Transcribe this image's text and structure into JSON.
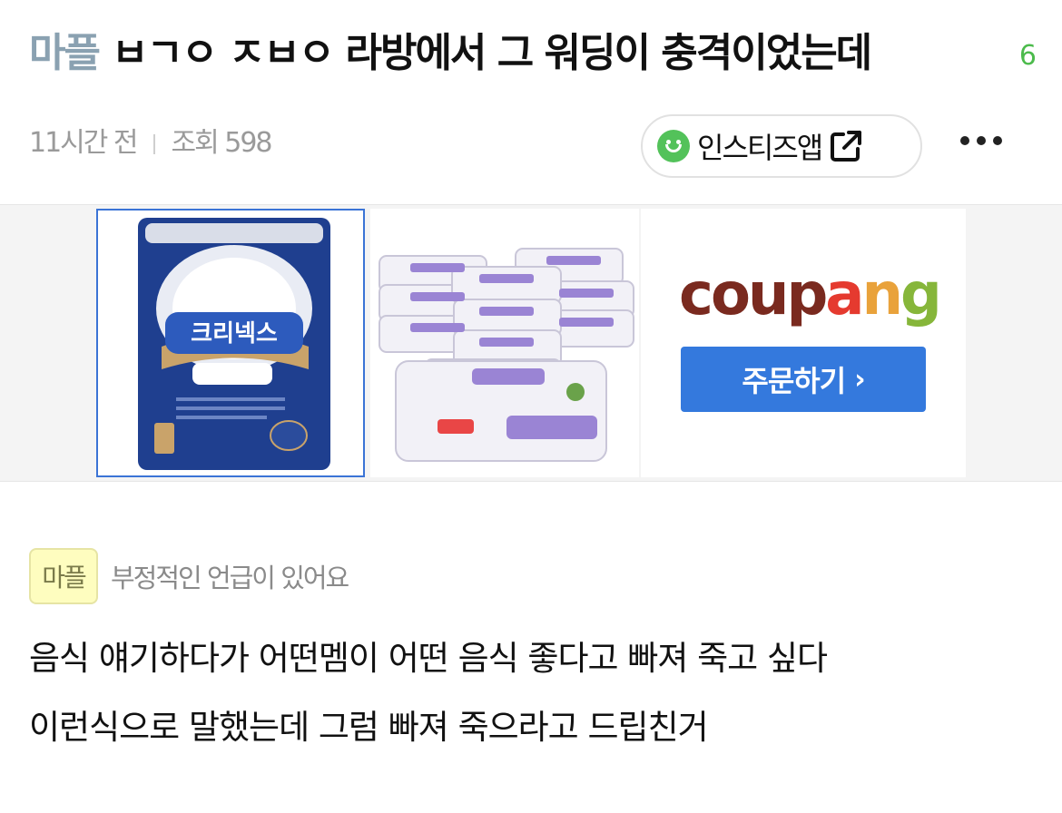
{
  "post": {
    "category": "마플",
    "title": "ㅂㄱㅇ ㅈㅂㅇ 라방에서 그 워딩이 충격이었는데",
    "comment_count": "6",
    "time_ago": "11시간 전",
    "views": "조회 598"
  },
  "header_actions": {
    "app_button_label": "인스티즈앱",
    "app_icon": "smile-icon",
    "share_icon": "external-link-icon",
    "more_icon": "more-dots-icon"
  },
  "ad": {
    "product1_text": "크리넥스",
    "brand": "coupang",
    "order_label": "주문하기",
    "order_chevron": "›",
    "brand_colors": [
      "#7a2a1f",
      "#7a2a1f",
      "#7a2a1f",
      "#7a2a1f",
      "#e53a2f",
      "#e9a23b",
      "#86b63a",
      "#3c9bd6"
    ]
  },
  "notice": {
    "badge": "마플",
    "text": "부정적인 언급이 있어요"
  },
  "body": {
    "lines": [
      "음식 얘기하다가 어떤멤이 어떤 음식 좋다고 빠져 죽고 싶다",
      "이런식으로 말했는데 그럼 빠져 죽으라고 드립친거"
    ]
  }
}
